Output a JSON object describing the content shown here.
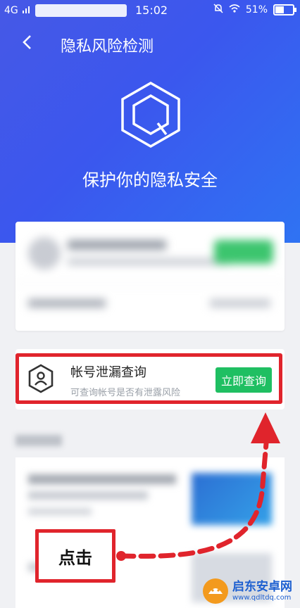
{
  "status_bar": {
    "network": "4G",
    "time": "15:02",
    "battery": "51%"
  },
  "nav": {
    "back_icon": "chevron-left-icon",
    "title": "隐私风险检测"
  },
  "hero": {
    "subtitle": "保护你的隐私安全"
  },
  "account_leak": {
    "title": "帐号泄漏查询",
    "description": "可查询帐号是否有泄露风险",
    "button_label": "立即查询"
  },
  "annotation": {
    "callout_label": "点击"
  },
  "watermark": {
    "main": "启东安卓网",
    "sub": "www.qdltdq.com"
  },
  "colors": {
    "hero_start": "#4658e6",
    "hero_end": "#2f73f3",
    "button_green": "#1fbf62",
    "highlight_red": "#e0242c"
  }
}
